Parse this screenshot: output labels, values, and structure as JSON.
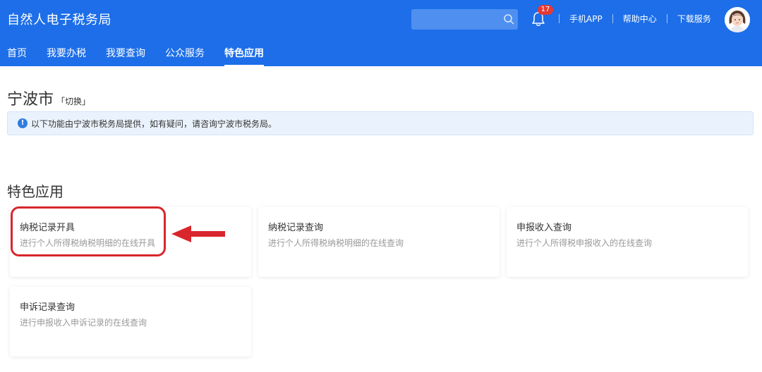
{
  "header": {
    "title": "自然人电子税务局",
    "search": {
      "placeholder": "",
      "icon": "search-icon"
    },
    "notifications": {
      "icon": "bell-icon",
      "count": "17"
    },
    "links": [
      "手机APP",
      "帮助中心",
      "下载服务"
    ],
    "avatar": "avatar-icon",
    "colors": {
      "bar": "#1d6ee8",
      "badge": "#e53935"
    }
  },
  "nav": {
    "items": [
      {
        "label": "首页",
        "active": false
      },
      {
        "label": "我要办税",
        "active": false
      },
      {
        "label": "我要查询",
        "active": false
      },
      {
        "label": "公众服务",
        "active": false
      },
      {
        "label": "特色应用",
        "active": true
      }
    ]
  },
  "location": {
    "city": "宁波市",
    "switch_label": "「切换」"
  },
  "notice": {
    "icon": "info-icon",
    "text": "以下功能由宁波市税务局提供，如有疑问，请咨询宁波市税务局。"
  },
  "section": {
    "title": "特色应用"
  },
  "cards": [
    {
      "title": "纳税记录开具",
      "desc": "进行个人所得税纳税明细的在线开具",
      "highlighted": true
    },
    {
      "title": "纳税记录查询",
      "desc": "进行个人所得税纳税明细的在线查询",
      "highlighted": false
    },
    {
      "title": "申报收入查询",
      "desc": "进行个人所得税申报收入的在线查询",
      "highlighted": false
    },
    {
      "title": "申诉记录查询",
      "desc": "进行申报收入申诉记录的在线查询",
      "highlighted": false
    }
  ],
  "annotation": {
    "color": "#d8262c",
    "shape": "rounded-rectangle-and-arrow"
  }
}
